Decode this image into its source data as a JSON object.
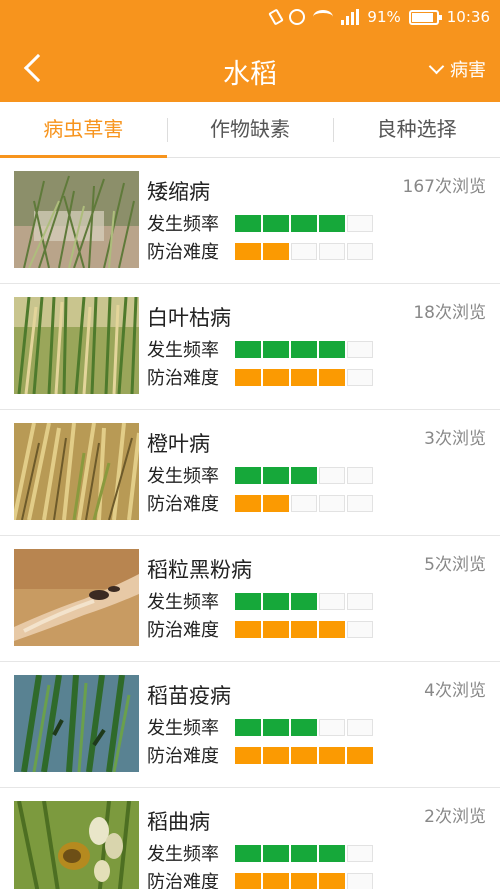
{
  "status_bar": {
    "battery": "91%",
    "time": "10:36"
  },
  "header": {
    "title": "水稻",
    "filter_label": "病害"
  },
  "tabs": [
    {
      "label": "病虫草害",
      "active": true
    },
    {
      "label": "作物缺素",
      "active": false
    },
    {
      "label": "良种选择",
      "active": false
    }
  ],
  "labels": {
    "frequency": "发生频率",
    "difficulty": "防治难度"
  },
  "colors": {
    "accent": "#f7941d",
    "frequency_bar": "#16a83a",
    "difficulty_bar": "#fb9a02"
  },
  "items": [
    {
      "name": "矮缩病",
      "views": "167次浏览",
      "frequency": 4,
      "difficulty": 2
    },
    {
      "name": "白叶枯病",
      "views": "18次浏览",
      "frequency": 4,
      "difficulty": 4
    },
    {
      "name": "橙叶病",
      "views": "3次浏览",
      "frequency": 3,
      "difficulty": 2
    },
    {
      "name": "稻粒黑粉病",
      "views": "5次浏览",
      "frequency": 3,
      "difficulty": 4
    },
    {
      "name": "稻苗疫病",
      "views": "4次浏览",
      "frequency": 3,
      "difficulty": 5
    },
    {
      "name": "稻曲病",
      "views": "2次浏览",
      "frequency": 4,
      "difficulty": 4
    }
  ]
}
